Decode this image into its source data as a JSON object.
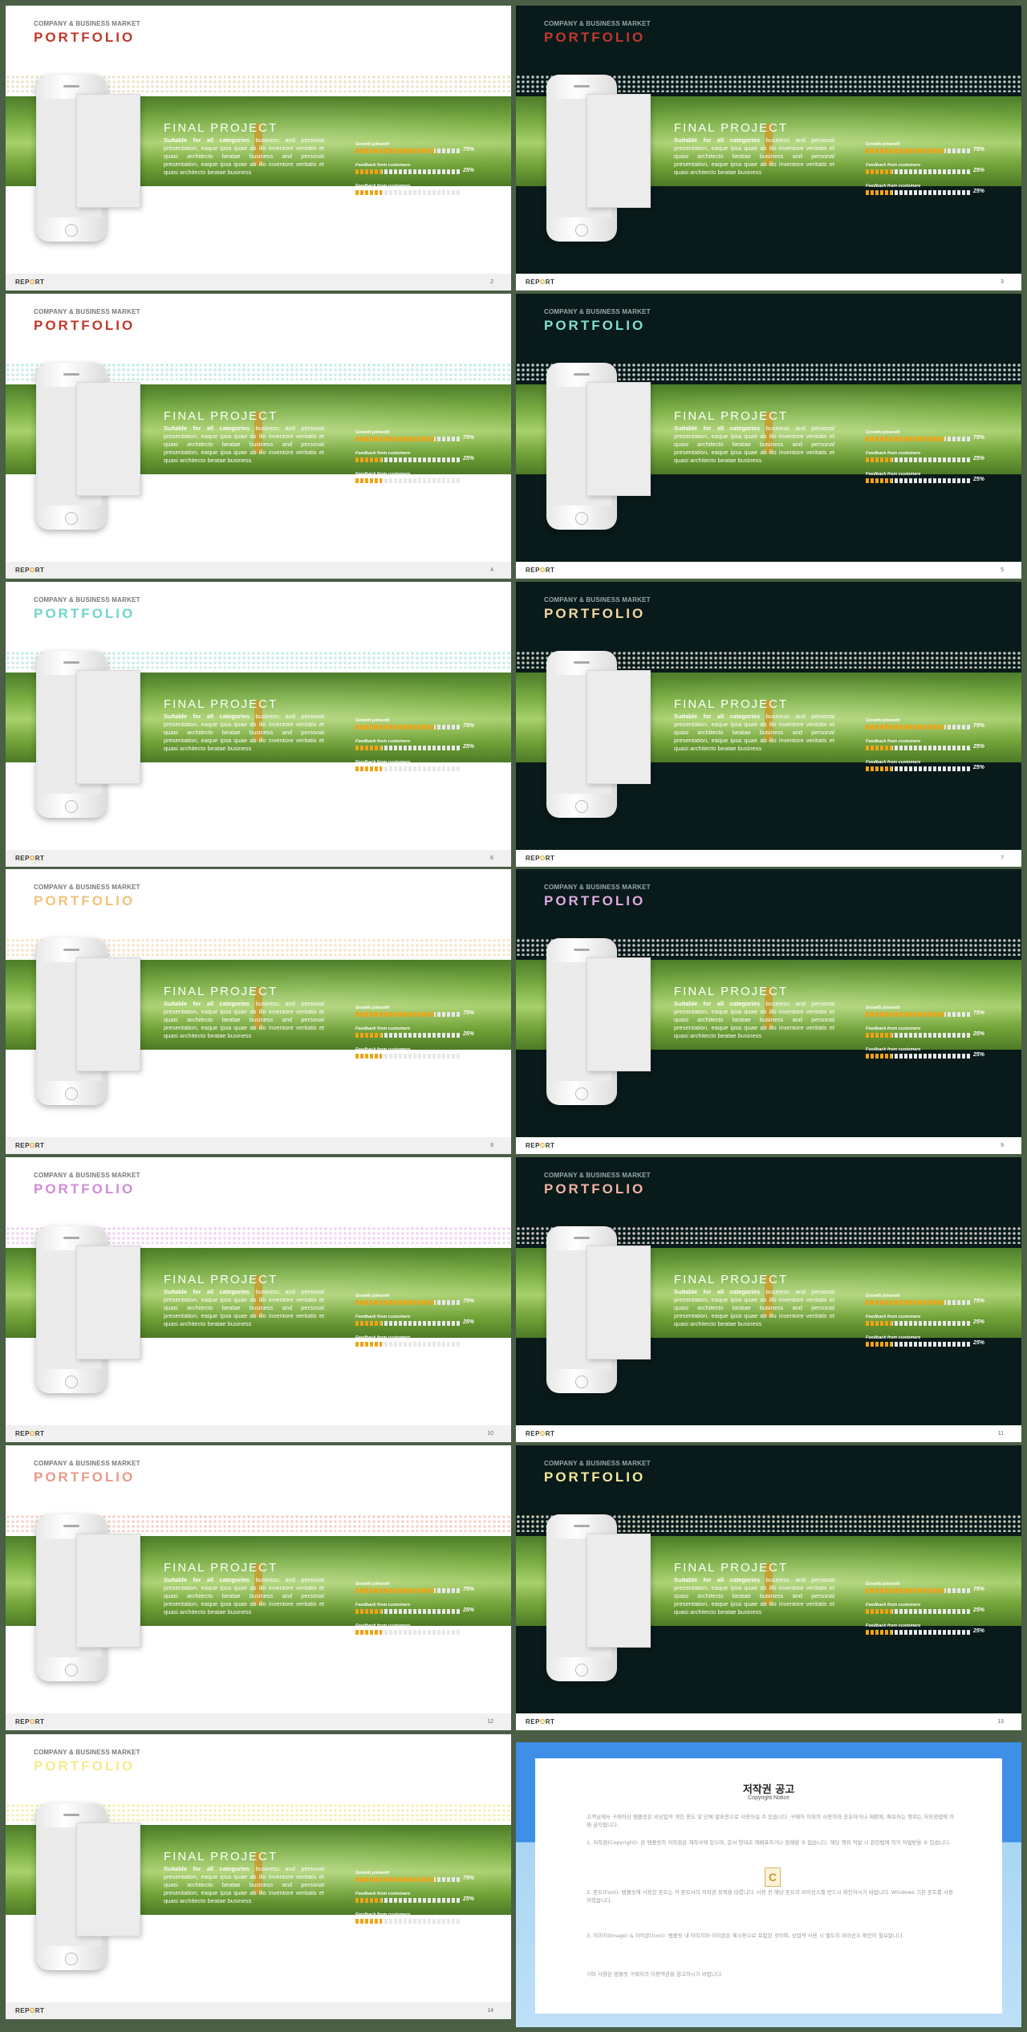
{
  "slide": {
    "company": "COMPANY & BUSINESS MARKET",
    "title": "PORTFOLIO",
    "heading": "FINAL PROJECT",
    "intro_bold": "Suitable for all categories",
    "body": " business and personal presentation, eaque ipsa quae ab illo inventore veritatis et quasi architecto beatae business and personal presentation, eaque ipsa quae ab illo inventore veritatis et quasi architecto beatae business",
    "bars": [
      {
        "label": "Growth p/month",
        "value": 75,
        "pct_text": "75%"
      },
      {
        "label": "Feedback from customers",
        "value": 25,
        "pct_text": "25%"
      },
      {
        "label": "Feedback from customers",
        "value": 25,
        "pct_text": "25%"
      }
    ],
    "footer_prefix": "REP",
    "footer_o": "O",
    "footer_suffix": "RT"
  },
  "slides": [
    {
      "number": "2",
      "theme": "light",
      "accent": "#c0392b",
      "dots": "#e8d9b8"
    },
    {
      "number": "3",
      "theme": "dark",
      "accent": "#c0392b",
      "dots": "#e8eef0"
    },
    {
      "number": "4",
      "theme": "light",
      "accent": "#c0392b",
      "dots": "#b8e6e2"
    },
    {
      "number": "5",
      "theme": "dark",
      "accent": "#7ee0d4",
      "dots": "#eef4f4"
    },
    {
      "number": "6",
      "theme": "light",
      "accent": "#6fd6cb",
      "dots": "#b8e6e2"
    },
    {
      "number": "7",
      "theme": "dark",
      "accent": "#f5d8a0",
      "dots": "#f2ece0"
    },
    {
      "number": "8",
      "theme": "light",
      "accent": "#f2c27a",
      "dots": "#f5dcb8"
    },
    {
      "number": "9",
      "theme": "dark",
      "accent": "#e0a9e0",
      "dots": "#f0eaf0"
    },
    {
      "number": "10",
      "theme": "light",
      "accent": "#d18ad6",
      "dots": "#e9c9ec"
    },
    {
      "number": "11",
      "theme": "dark",
      "accent": "#f3b3a3",
      "dots": "#f4e8e4"
    },
    {
      "number": "12",
      "theme": "light",
      "accent": "#e89a88",
      "dots": "#f2c6bc"
    },
    {
      "number": "13",
      "theme": "dark",
      "accent": "#f6e79a",
      "dots": "#f4f0da"
    },
    {
      "number": "14",
      "theme": "light",
      "accent": "#f5ea8c",
      "dots": "#f3ec9e"
    }
  ],
  "copyright": {
    "title": "저작권 공고",
    "subtitle": "Copyright Notice",
    "logo_letter": "C",
    "paragraphs": [
      "고객님께서 구매하신 템플릿은 비상업적 개인 용도 및 단체 발표용으로 사용하실 수 있습니다. 구매자 이외의 사용자와 공유하거나 재판매, 배포하는 행위는 저작권법에 의해 금지됩니다.",
      "1. 저작권(Copyright): 본 템플릿의 저작권은 제작사에 있으며, 문서 형태로 재배포하거나 판매할 수 없습니다. 해당 행위 적발 시 관련법에 의거 처벌받을 수 있습니다.",
      "2. 폰트(Font): 템플릿에 사용된 폰트는 각 폰트사의 저작권 정책을 따릅니다. 사용 전 해당 폰트의 라이선스를 반드시 확인하시기 바랍니다. Windows 기본 폰트를 사용하였습니다.",
      "3. 이미지(Image) & 아이콘(Icon): 템플릿 내 이미지와 아이콘은 예시용으로 포함된 것이며, 상업적 사용 시 별도의 라이선스 확인이 필요합니다.",
      "기타 사항은 템플릿 구매처의 이용약관을 참고하시기 바랍니다."
    ]
  }
}
